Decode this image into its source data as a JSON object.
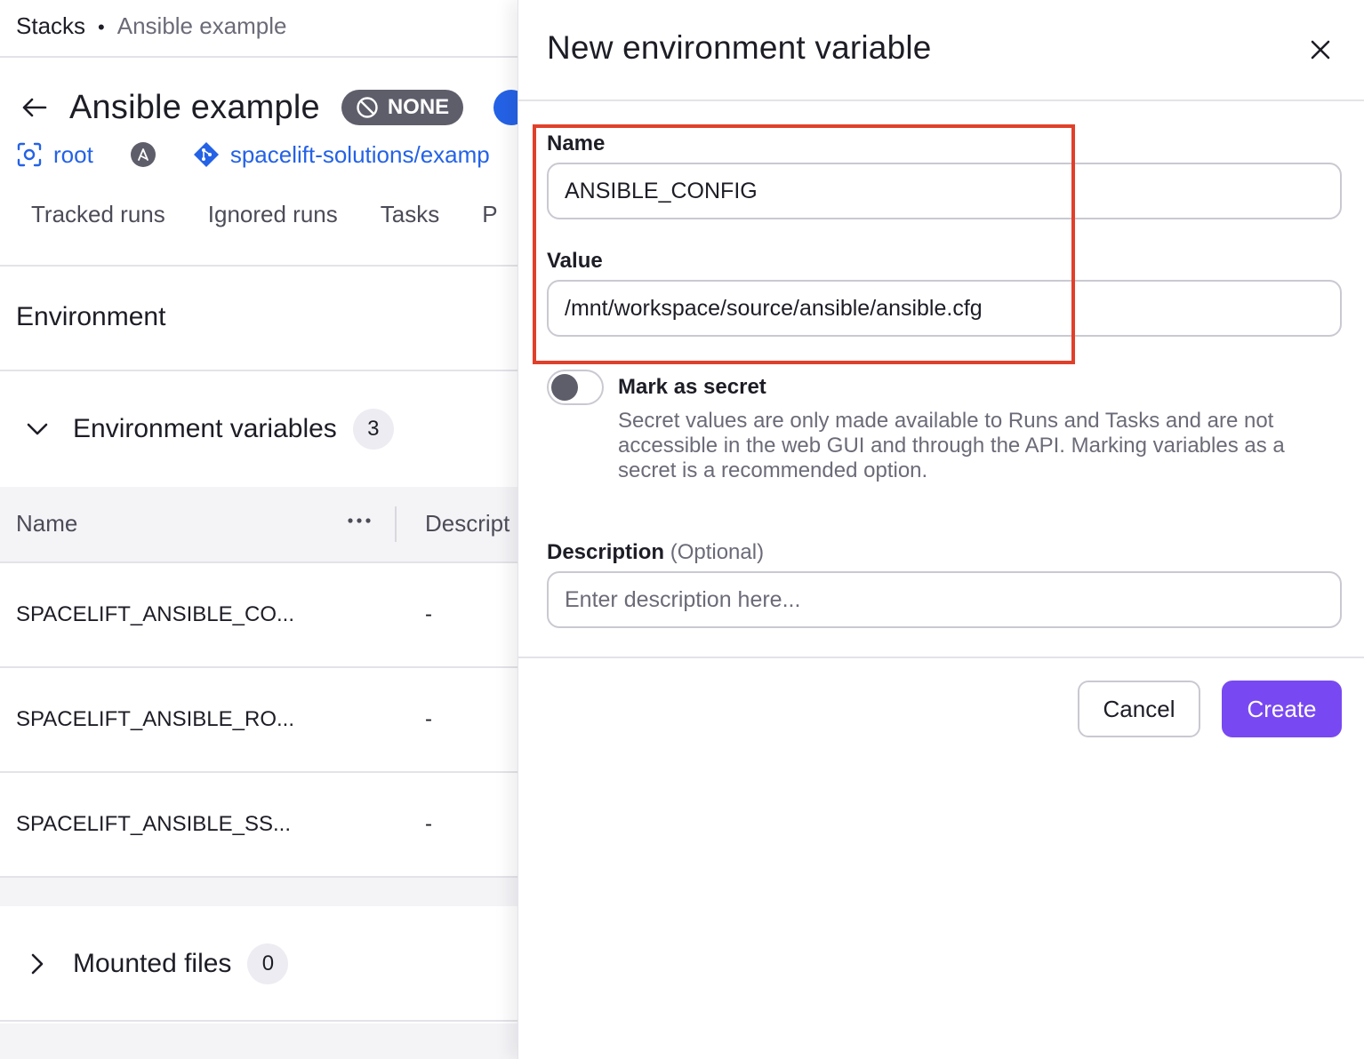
{
  "breadcrumb": {
    "root": "Stacks",
    "separator": "•",
    "current": "Ansible example"
  },
  "stack": {
    "title": "Ansible example",
    "state_badge": "NONE",
    "space": "root",
    "repository": "spacelift-solutions/examp"
  },
  "tabs": [
    "Tracked runs",
    "Ignored runs",
    "Tasks",
    "P"
  ],
  "section": {
    "title": "Environment"
  },
  "env_vars": {
    "title": "Environment variables",
    "count": "3",
    "columns": {
      "name": "Name",
      "description": "Descript"
    },
    "rows": [
      {
        "name": "SPACELIFT_ANSIBLE_CO...",
        "description": "-"
      },
      {
        "name": "SPACELIFT_ANSIBLE_RO...",
        "description": "-"
      },
      {
        "name": "SPACELIFT_ANSIBLE_SS...",
        "description": "-"
      }
    ]
  },
  "mounted_files": {
    "title": "Mounted files",
    "count": "0"
  },
  "drawer": {
    "title": "New environment variable",
    "name_label": "Name",
    "name_value": "ANSIBLE_CONFIG",
    "value_label": "Value",
    "value_value": "/mnt/workspace/source/ansible/ansible.cfg",
    "secret_label": "Mark as secret",
    "secret_enabled": false,
    "secret_help": "Secret values are only made available to Runs and Tasks and are not accessible in the web GUI and through the API. Marking variables as a secret is a recommended option.",
    "description_label": "Description",
    "description_optional": "(Optional)",
    "description_placeholder": "Enter description here...",
    "description_value": "",
    "cancel_label": "Cancel",
    "create_label": "Create"
  },
  "colors": {
    "accent_primary": "#7849f2",
    "link": "#2462e6",
    "highlight_annotation": "#e0402a",
    "badge_dark": "#5e5e6b"
  }
}
